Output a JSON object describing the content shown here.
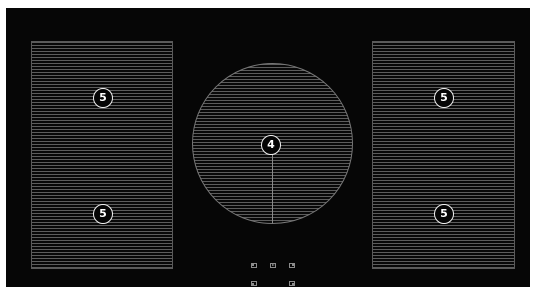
{
  "cooktop": {
    "zones": [
      {
        "id": "front-left",
        "power_level": "5"
      },
      {
        "id": "rear-left",
        "power_level": "5"
      },
      {
        "id": "center",
        "power_level": "4"
      },
      {
        "id": "front-right",
        "power_level": "5"
      },
      {
        "id": "rear-right",
        "power_level": "5"
      }
    ],
    "controls": [
      {
        "icon": "zone-top-left-icon"
      },
      {
        "icon": "play-icon"
      },
      {
        "icon": "zone-top-right-icon"
      },
      {
        "icon": "zone-bottom-left-icon"
      },
      {
        "icon": "zone-bottom-right-icon"
      }
    ],
    "colors": {
      "surface": "#060606",
      "zone_lines": "#5c5c5c",
      "badge_border": "#f2f2f2"
    }
  }
}
